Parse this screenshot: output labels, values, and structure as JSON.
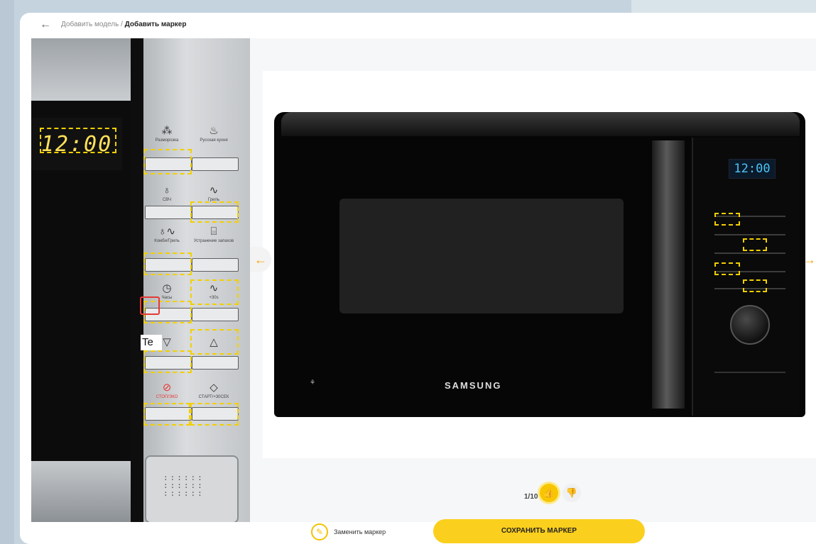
{
  "header": {
    "back_icon": "arrow-left-icon",
    "breadcrumb_prev": "Добавить модель",
    "breadcrumb_sep": "/",
    "breadcrumb_current": "Добавить маркер"
  },
  "left_panel": {
    "display_digits": "12:00",
    "buttons": [
      {
        "icon": "⁂",
        "label": "Разморозка"
      },
      {
        "icon": "♨",
        "label": "Русская кухня"
      },
      {
        "icon": "♁",
        "label": "СВЧ"
      },
      {
        "icon": "∿",
        "label": "Гриль"
      },
      {
        "icon": "♁∿",
        "label": "Комби/Гриль"
      },
      {
        "icon": "⌸",
        "label": "Устранение запахов"
      },
      {
        "icon": "◷",
        "label": "Часы"
      },
      {
        "icon": "∿",
        "label": "+30s"
      },
      {
        "icon": "▽",
        "label": ""
      },
      {
        "icon": "△",
        "label": ""
      },
      {
        "icon": "⊘",
        "label": "СТОП/ЭКО"
      },
      {
        "icon": "◇",
        "label": "СТАРТ/+30СЕК"
      }
    ],
    "popup_text": "Te"
  },
  "main": {
    "microwave_display": "12:00",
    "brand": "SAMSUNG",
    "pager": "1/10",
    "like_icon": "thumb-up-icon",
    "dislike_icon": "thumb-down-icon"
  },
  "footer": {
    "replace_label": "Заменить маркер",
    "save_label": "СОХРАНИТЬ МАРКЕР"
  },
  "colors": {
    "accent": "#fbcf1d",
    "marker": "#f2d000",
    "selected_marker": "#e53935",
    "nav_arrow": "#f7a600"
  }
}
